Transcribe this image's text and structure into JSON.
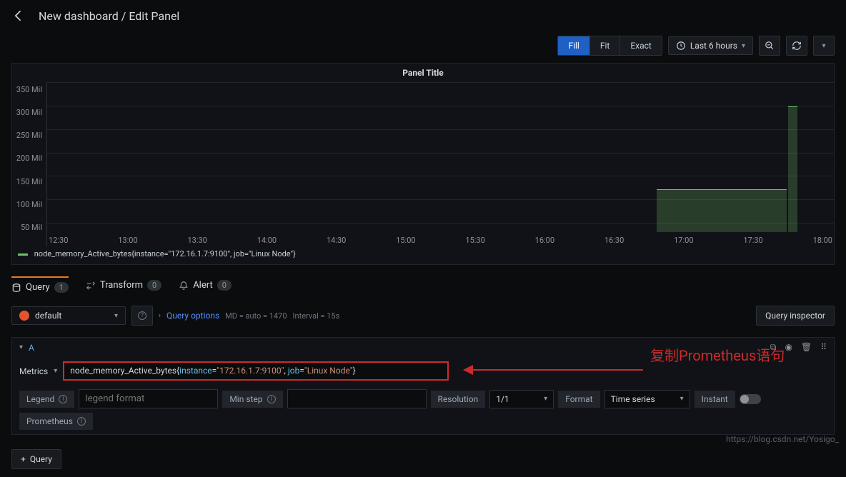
{
  "header": {
    "title": "New dashboard / Edit Panel"
  },
  "toolbar": {
    "fill": "Fill",
    "fit": "Fit",
    "exact": "Exact",
    "time_label": "Last 6 hours"
  },
  "panel": {
    "title": "Panel Title",
    "legend": "node_memory_Active_bytes{instance=\"172.16.1.7:9100\", job=\"Linux Node\"}"
  },
  "chart_data": {
    "type": "area",
    "title": "Panel Title",
    "ylabel": "",
    "xlabel": "",
    "ylim": [
      0,
      350000000
    ],
    "y_ticks": [
      "350 Mil",
      "300 Mil",
      "250 Mil",
      "200 Mil",
      "150 Mil",
      "100 Mil",
      "50 Mil"
    ],
    "x_ticks": [
      "12:30",
      "13:00",
      "13:30",
      "14:00",
      "14:30",
      "15:00",
      "15:30",
      "16:00",
      "16:30",
      "17:00",
      "17:30",
      "18:00"
    ],
    "series": [
      {
        "name": "node_memory_Active_bytes{instance=\"172.16.1.7:9100\", job=\"Linux Node\"}",
        "x": [
          "16:47",
          "17:00",
          "17:30",
          "17:35",
          "17:37"
        ],
        "values": [
          105000000,
          105000000,
          105000000,
          105000000,
          305000000
        ]
      }
    ]
  },
  "tabs": {
    "query_label": "Query",
    "query_count": "1",
    "transform_label": "Transform",
    "transform_count": "0",
    "alert_label": "Alert",
    "alert_count": "0"
  },
  "datasource": {
    "name": "default",
    "query_options": "Query options",
    "meta_md": "MD = auto = 1470",
    "meta_interval": "Interval = 15s",
    "inspector": "Query inspector"
  },
  "query": {
    "id": "A",
    "metrics_label": "Metrics",
    "expr_fn1": "instance",
    "expr_str1": "\"172.16.1.7:9100\"",
    "expr_fn2": "job",
    "expr_str2": "\"Linux Node\"",
    "expr_head": "node_memory_Active_bytes{",
    "expr_tail": "}",
    "legend_label": "Legend",
    "legend_placeholder": "legend format",
    "minstep_label": "Min step",
    "resolution_label": "Resolution",
    "resolution_val": "1/1",
    "format_label": "Format",
    "format_val": "Time series",
    "instant_label": "Instant",
    "prom_label": "Prometheus"
  },
  "annotation": "复制Prometheus语句",
  "add_query": "Query",
  "watermark": "https://blog.csdn.net/Yosigo_"
}
